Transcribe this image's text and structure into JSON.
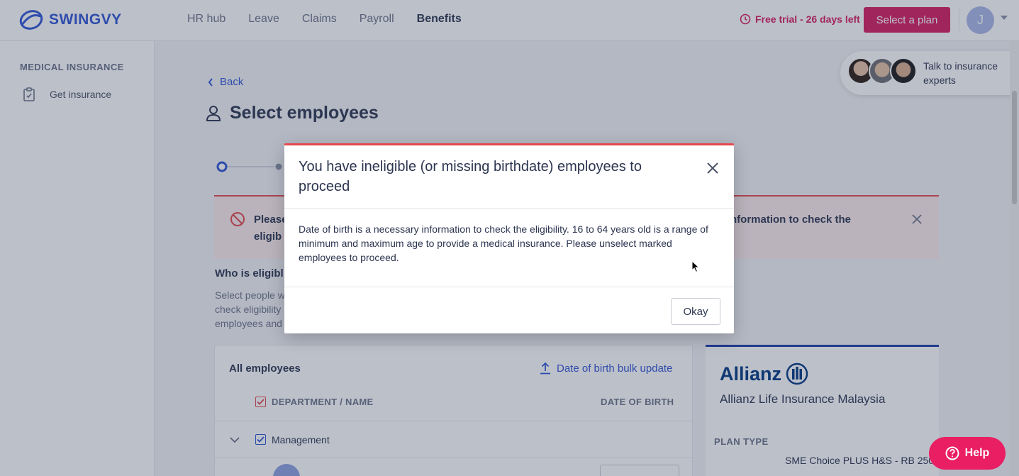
{
  "nav": {
    "brand": "SWINGVY",
    "links": [
      "HR hub",
      "Leave",
      "Claims",
      "Payroll",
      "Benefits"
    ],
    "active_link": "Benefits",
    "trial_text": "Free trial - 26 days left",
    "select_plan_label": "Select a plan",
    "avatar_initial": "J"
  },
  "sidebar": {
    "heading": "MEDICAL INSURANCE",
    "items": [
      {
        "label": "Get insurance",
        "icon": "clipboard-icon"
      }
    ]
  },
  "page": {
    "back_label": "Back",
    "title": "Select employees",
    "alert": {
      "text_start": "Please",
      "text_end": "nformation to check the",
      "text_line2": "eligib"
    },
    "who": {
      "title": "Who is eligibl",
      "lines": [
        "Select people w",
        "check eligibility",
        "employees and"
      ]
    },
    "employees": {
      "title": "All employees",
      "bulk_update_label": "Date of birth bulk update",
      "col_dept": "DEPARTMENT / NAME",
      "col_dob": "DATE OF BIRTH",
      "rows": [
        {
          "label": "Management"
        }
      ]
    },
    "insurer": {
      "logo_text": "Allianz",
      "name": "Allianz Life Insurance Malaysia",
      "plan_type_label": "PLAN TYPE",
      "plan_type_value": "SME Choice PLUS H&S - RB 250"
    },
    "experts_label": "Talk to insurance experts",
    "help_label": "Help"
  },
  "modal": {
    "title": "You have ineligible (or missing birthdate) employees to proceed",
    "body": "Date of birth is a necessary information to check the eligibility. 16 to 64 years old is a range of minimum and maximum age to provide a medical insurance. Please unselect marked employees to proceed.",
    "okay_label": "Okay"
  },
  "colors": {
    "brand_blue": "#2f55d4",
    "accent_pink": "#d81b60",
    "error_red": "#e5484d",
    "allianz_blue": "#003781"
  }
}
